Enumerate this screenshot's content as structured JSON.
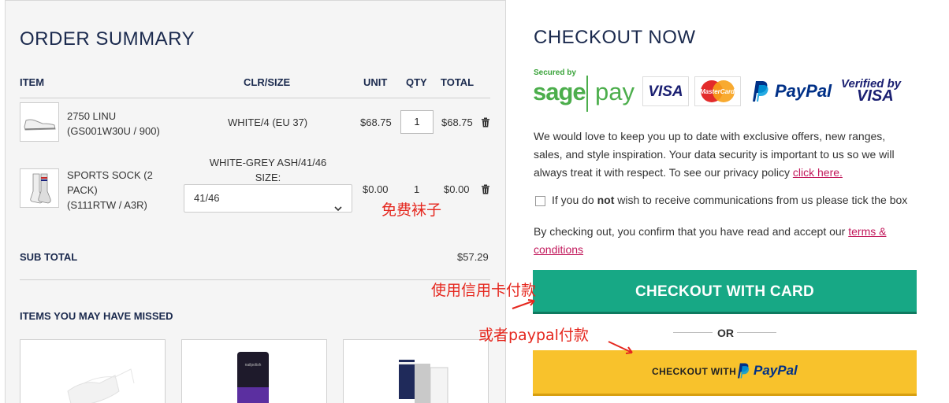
{
  "order_summary": {
    "title": "ORDER SUMMARY",
    "headers": {
      "item": "ITEM",
      "clr": "CLR/SIZE",
      "unit": "UNIT",
      "qty": "QTY",
      "total": "TOTAL"
    },
    "items": [
      {
        "name_line1": "2750 LINU",
        "name_line2": "(GS001W30U / 900)",
        "clr": "WHITE/4 (EU 37)",
        "unit": "$68.75",
        "qty": "1",
        "total": "$68.75",
        "icon": "trash-icon"
      },
      {
        "name_line1": "SPORTS SOCK (2",
        "name_line2": "PACK)",
        "name_line3": "(S111RTW / A3R)",
        "clr_line1": "WHITE-GREY ASH/41/46",
        "clr_line2": "SIZE:",
        "size_selected": "41/46",
        "unit": "$0.00",
        "qty": "1",
        "total": "$0.00",
        "icon": "trash-icon"
      }
    ],
    "annotation_free_socks": "免费袜子",
    "subtotal_label": "SUB TOTAL",
    "subtotal_value": "$57.29",
    "missed_title": "ITEMS YOU MAY HAVE MISSED"
  },
  "checkout": {
    "title": "CHECKOUT NOW",
    "secured_by": "Secured by",
    "sage": "sage",
    "pay": "pay",
    "visa": "VISA",
    "mastercard": "MasterCard",
    "paypal": "PayPal",
    "vbv_line1": "Verified by",
    "vbv_line2": "VISA",
    "newsletter_text": "We would love to keep you up to date with exclusive offers, new ranges, sales, and style inspiration. Your data security is important to us so we will always treat it with respect. To see our privacy policy ",
    "privacy_link": "click here.",
    "optout_pre": "If you do ",
    "optout_bold": "not",
    "optout_post": " wish to receive communications from us please tick the box",
    "terms_pre": "By checking out, you confirm that you have read and accept our ",
    "terms_link": "terms & conditions",
    "card_button": "CHECKOUT WITH CARD",
    "or": "OR",
    "paypal_button_label": "CHECKOUT WITH",
    "paypal_button_logo": "PayPal"
  },
  "annotations": {
    "card": "使用信用卡付款",
    "paypal": "或者paypal付款"
  },
  "colors": {
    "navy": "#1b2a4e",
    "green_button": "#17a885",
    "paypal_yellow": "#f8c22c",
    "annotation_red": "#e5271e",
    "link": "#c2185b"
  }
}
